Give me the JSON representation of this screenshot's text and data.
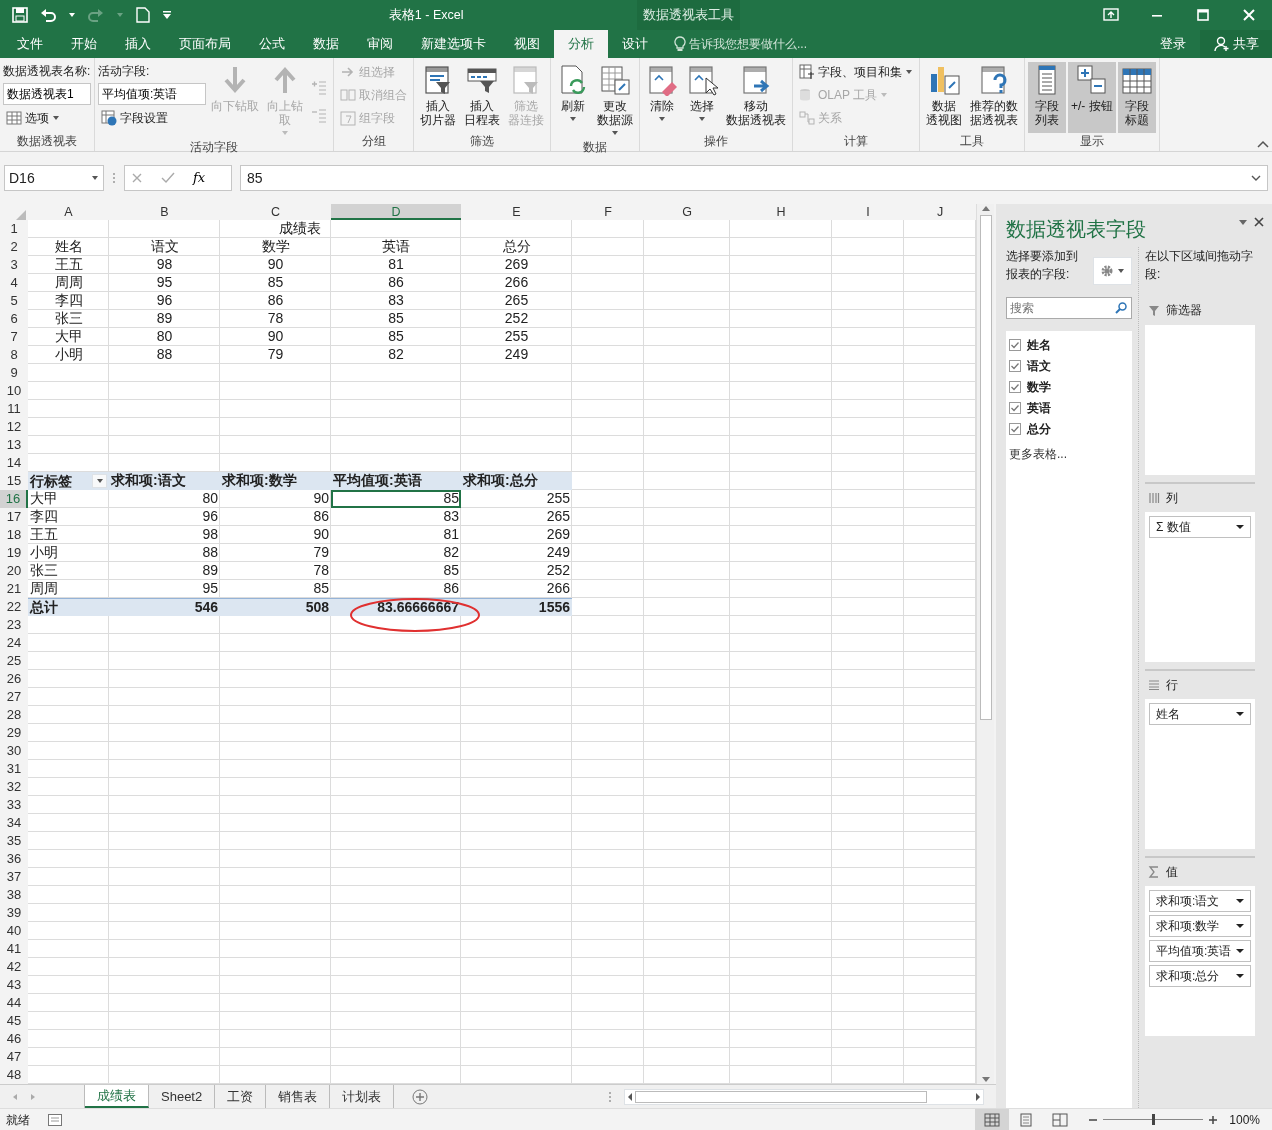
{
  "title_bar": {
    "title": "表格1 - Excel",
    "context_title": "数据透视表工具"
  },
  "tabs": [
    {
      "label": "文件",
      "selected": false
    },
    {
      "label": "开始",
      "selected": false
    },
    {
      "label": "插入",
      "selected": false
    },
    {
      "label": "页面布局",
      "selected": false
    },
    {
      "label": "公式",
      "selected": false
    },
    {
      "label": "数据",
      "selected": false
    },
    {
      "label": "审阅",
      "selected": false
    },
    {
      "label": "新建选项卡",
      "selected": false
    },
    {
      "label": "视图",
      "selected": false
    },
    {
      "label": "分析",
      "selected": true
    },
    {
      "label": "设计",
      "selected": false
    }
  ],
  "tell_me": "告诉我您想要做什么...",
  "sign_in": "登录",
  "share": "共享",
  "ribbon": {
    "groups": [
      {
        "label": "数据透视表",
        "items": [
          {
            "kind": "caption",
            "text": "数据透视表名称:"
          },
          {
            "kind": "field",
            "value": "数据透视表1"
          },
          {
            "kind": "small",
            "text": "选项",
            "dropdown": true,
            "disabled": false
          }
        ]
      },
      {
        "label": "活动字段",
        "items": [
          {
            "kind": "caption",
            "text": "活动字段:"
          },
          {
            "kind": "field",
            "value": "平均值项:英语"
          },
          {
            "kind": "small",
            "text": "字段设置",
            "dropdown": false,
            "disabled": false
          },
          {
            "kind": "large",
            "lines": [
              "向下钻取"
            ],
            "dropdown": false,
            "disabled": true
          },
          {
            "kind": "large",
            "lines": [
              "向上钻",
              "取"
            ],
            "dropdown": true,
            "disabled": true
          },
          {
            "kind": "icon",
            "disabled": true
          },
          {
            "kind": "icon",
            "disabled": true
          }
        ]
      },
      {
        "label": "分组",
        "items": [
          {
            "kind": "small",
            "text": "组选择",
            "dropdown": false,
            "disabled": true
          },
          {
            "kind": "small",
            "text": "取消组合",
            "dropdown": false,
            "disabled": true
          },
          {
            "kind": "small",
            "text": "组字段",
            "dropdown": false,
            "disabled": true
          }
        ]
      },
      {
        "label": "筛选",
        "items": [
          {
            "kind": "large",
            "lines": [
              "插入",
              "切片器"
            ],
            "dropdown": false,
            "disabled": false
          },
          {
            "kind": "large",
            "lines": [
              "插入",
              "日程表"
            ],
            "dropdown": false,
            "disabled": false
          },
          {
            "kind": "large",
            "lines": [
              "筛选",
              "器连接"
            ],
            "dropdown": false,
            "disabled": true
          }
        ]
      },
      {
        "label": "数据",
        "items": [
          {
            "kind": "large",
            "lines": [
              "刷新"
            ],
            "dropdown": true,
            "disabled": false
          },
          {
            "kind": "large",
            "lines": [
              "更改",
              "数据源"
            ],
            "dropdown": true,
            "disabled": false
          }
        ]
      },
      {
        "label": "操作",
        "items": [
          {
            "kind": "large",
            "lines": [
              "清除"
            ],
            "dropdown": true,
            "disabled": false
          },
          {
            "kind": "large",
            "lines": [
              "选择"
            ],
            "dropdown": true,
            "disabled": false
          },
          {
            "kind": "large",
            "lines": [
              "移动",
              "数据透视表"
            ],
            "dropdown": false,
            "disabled": false
          }
        ]
      },
      {
        "label": "计算",
        "items": [
          {
            "kind": "small",
            "text": "字段、项目和集",
            "dropdown": true,
            "disabled": false
          },
          {
            "kind": "small",
            "text": "OLAP 工具",
            "dropdown": true,
            "disabled": true
          },
          {
            "kind": "small",
            "text": "关系",
            "dropdown": false,
            "disabled": true
          }
        ]
      },
      {
        "label": "工具",
        "items": [
          {
            "kind": "large",
            "lines": [
              "数据",
              "透视图"
            ],
            "dropdown": false,
            "disabled": false
          },
          {
            "kind": "large",
            "lines": [
              "推荐的数",
              "据透视表"
            ],
            "dropdown": false,
            "disabled": false
          }
        ]
      },
      {
        "label": "显示",
        "items": [
          {
            "kind": "large",
            "lines": [
              "字段",
              "列表"
            ],
            "dropdown": false,
            "disabled": false,
            "on": true
          },
          {
            "kind": "large",
            "lines": [
              "+/- 按钮"
            ],
            "dropdown": false,
            "disabled": false,
            "on": true
          },
          {
            "kind": "large",
            "lines": [
              "字段",
              "标题"
            ],
            "dropdown": false,
            "disabled": false,
            "on": true
          }
        ]
      }
    ]
  },
  "formula_bar": {
    "name_box": "D16",
    "function_label": "fx",
    "value": "85"
  },
  "sheet": {
    "columns": [
      "A",
      "B",
      "C",
      "D",
      "E",
      "F",
      "G",
      "H",
      "I",
      "J"
    ],
    "row_numbers": [
      "1",
      "2",
      "3",
      "4",
      "5",
      "6",
      "7",
      "8",
      "9",
      "10",
      "11",
      "12",
      "13",
      "14",
      "15",
      "16",
      "17",
      "18",
      "19",
      "20",
      "21",
      "22",
      "23",
      "24",
      "25",
      "26",
      "27",
      "28",
      "29",
      "30",
      "31",
      "32",
      "33",
      "34",
      "35",
      "36",
      "37",
      "38",
      "39",
      "40",
      "41",
      "42",
      "43",
      "44",
      "45",
      "46",
      "47",
      "48"
    ],
    "title": "成绩表",
    "table_header": [
      "姓名",
      "语文",
      "数学",
      "英语",
      "总分"
    ],
    "table_rows": [
      [
        "王五",
        "98",
        "90",
        "81",
        "269"
      ],
      [
        "周周",
        "95",
        "85",
        "86",
        "266"
      ],
      [
        "李四",
        "96",
        "86",
        "83",
        "265"
      ],
      [
        "张三",
        "89",
        "78",
        "85",
        "252"
      ],
      [
        "大甲",
        "80",
        "90",
        "85",
        "255"
      ],
      [
        "小明",
        "88",
        "79",
        "82",
        "249"
      ]
    ],
    "pivot": {
      "header": [
        "行标签",
        "求和项:语文",
        "求和项:数学",
        "平均值项:英语",
        "求和项:总分"
      ],
      "filter_button": true,
      "rows": [
        {
          "cells": [
            {
              "text": "大甲",
              "selected": false
            },
            {
              "text": "80",
              "selected": false
            },
            {
              "text": "90",
              "selected": false
            },
            {
              "text": "85",
              "selected": true
            },
            {
              "text": "255",
              "selected": false
            }
          ]
        },
        {
          "cells": [
            {
              "text": "李四",
              "selected": false
            },
            {
              "text": "96",
              "selected": false
            },
            {
              "text": "86",
              "selected": false
            },
            {
              "text": "83",
              "selected": false
            },
            {
              "text": "265",
              "selected": false
            }
          ]
        },
        {
          "cells": [
            {
              "text": "王五",
              "selected": false
            },
            {
              "text": "98",
              "selected": false
            },
            {
              "text": "90",
              "selected": false
            },
            {
              "text": "81",
              "selected": false
            },
            {
              "text": "269",
              "selected": false
            }
          ]
        },
        {
          "cells": [
            {
              "text": "小明",
              "selected": false
            },
            {
              "text": "88",
              "selected": false
            },
            {
              "text": "79",
              "selected": false
            },
            {
              "text": "82",
              "selected": false
            },
            {
              "text": "249",
              "selected": false
            }
          ]
        },
        {
          "cells": [
            {
              "text": "张三",
              "selected": false
            },
            {
              "text": "89",
              "selected": false
            },
            {
              "text": "78",
              "selected": false
            },
            {
              "text": "85",
              "selected": false
            },
            {
              "text": "252",
              "selected": false
            }
          ]
        },
        {
          "cells": [
            {
              "text": "周周",
              "selected": false
            },
            {
              "text": "95",
              "selected": false
            },
            {
              "text": "85",
              "selected": false
            },
            {
              "text": "86",
              "selected": false
            },
            {
              "text": "266",
              "selected": false
            }
          ]
        }
      ],
      "total": [
        {
          "text": "总计",
          "circled": false
        },
        {
          "text": "546",
          "circled": false
        },
        {
          "text": "508",
          "circled": false
        },
        {
          "text": "83.66666667",
          "circled": true
        },
        {
          "text": "1556",
          "circled": false
        }
      ]
    }
  },
  "sheet_tabs": [
    {
      "label": "成绩表",
      "selected": true
    },
    {
      "label": "Sheet2",
      "selected": false
    },
    {
      "label": "工资",
      "selected": false
    },
    {
      "label": "销售表",
      "selected": false
    },
    {
      "label": "计划表",
      "selected": false
    }
  ],
  "panel": {
    "title": "数据透视表字段",
    "instruction": "选择要添加到报表的字段:",
    "search_placeholder": "搜索",
    "fields": [
      {
        "label": "姓名",
        "checked": true
      },
      {
        "label": "语文",
        "checked": true
      },
      {
        "label": "数学",
        "checked": true
      },
      {
        "label": "英语",
        "checked": true
      },
      {
        "label": "总分",
        "checked": true
      }
    ],
    "more_tables": "更多表格...",
    "areas_instruction": "在以下区域间拖动字段:",
    "areas": [
      {
        "kind": "filters",
        "label": "筛选器"
      },
      {
        "kind": "columns",
        "label": "列",
        "items": [
          "Σ 数值"
        ]
      },
      {
        "kind": "rows",
        "label": "行",
        "items": [
          "姓名"
        ]
      },
      {
        "kind": "values",
        "label": "值",
        "items": [
          "求和项:语文",
          "求和项:数学",
          "平均值项:英语",
          "求和项:总分"
        ]
      }
    ]
  },
  "status_bar": {
    "status": "就绪",
    "views": [
      {
        "selected": true
      },
      {
        "selected": false
      },
      {
        "selected": false
      }
    ],
    "zoom": {
      "level": 0.5,
      "reading": "100%"
    }
  }
}
